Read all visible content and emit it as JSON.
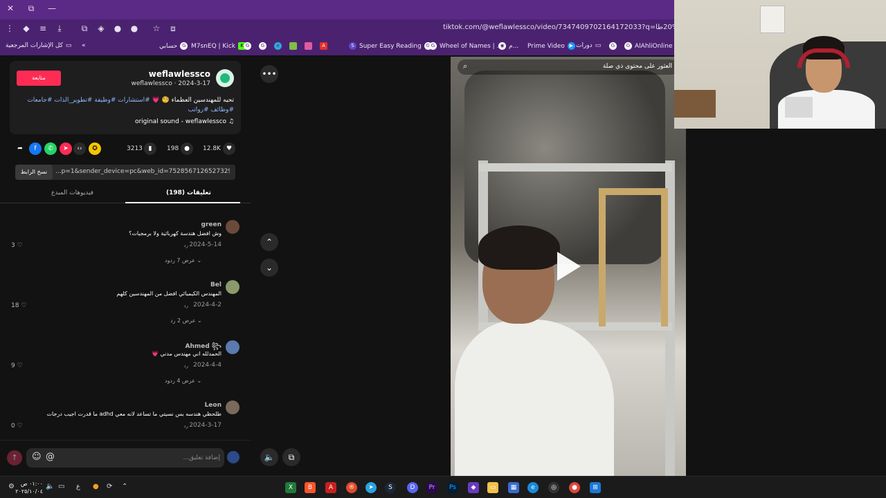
{
  "window": {
    "close": "✕",
    "restore": "⧉",
    "minimize": "—"
  },
  "toolbar": {
    "url": "tiktok.com/@weflawlessco/video/7347409702164172033?q=مهندس%20%20طا"
  },
  "bookmarks": [
    {
      "label": "كل الإشارات المرجعية"
    },
    {
      "label": "حسابي"
    },
    {
      "label": "M7snEQ | Kick"
    },
    {
      "label": "دورات"
    },
    {
      "label": "Prime Video"
    },
    {
      "label": "م..."
    },
    {
      "label": "Wheel of Names | ..."
    },
    {
      "label": "Super Easy Reading"
    },
    {
      "label": "AlAhliOnline"
    }
  ],
  "post": {
    "username": "weflawlessco",
    "meta": "weflawlessco · 2024-3-17",
    "follow_label": "متابعة",
    "caption_text": "تحيه للمهندسين العظماء 🧐 💗",
    "caption_tags": "#استشارات #وظيفة #تطوير_الذات #جامعات #وظائف #رواتب",
    "sound": "original sound - weflawlessco ♫",
    "likes": "12.8K",
    "comments": "198",
    "saves": "3213",
    "copy_link_label": "نسخ الرابط",
    "link": "...p=1&sender_device=pc&web_id=7528567126527329810"
  },
  "tabs": {
    "comments": "تعليقات (198)",
    "creator_videos": "فيديوهات المبدع"
  },
  "comments": [
    {
      "name": "green",
      "text": "وش افضل هندسة كهربائية ولا برمجيات؟",
      "date": "2024-5-14",
      "reply": "رد",
      "likes": "3 ♡",
      "view_replies": "عرض 7 ردود ⌄"
    },
    {
      "name": "Bel",
      "text": "المهندس الكيميائي افضل من المهندسين كلهم",
      "date": "2024-4-2",
      "reply": "رد",
      "likes": "18 ♡",
      "view_replies": "عرض 2 رد ⌄"
    },
    {
      "name": "Ahmed ꧂",
      "text": "الحمدلله اني مهندس مدني 💗",
      "date": "2024-4-4",
      "reply": "رد",
      "likes": "9 ♡",
      "view_replies": "عرض 4 ردود ⌄"
    },
    {
      "name": "Leon",
      "text": "طلحظي هندسه بس نسيتي ما تساعد لانه معي adhd ما قدرت اجيب درجات",
      "date": "2024-3-17",
      "reply": "رد",
      "likes": "0 ♡",
      "view_replies": ""
    }
  ],
  "comment_input": {
    "placeholder": "إضافة تعليق..."
  },
  "video": {
    "search_text": "العثور على محتوى ذي صلة"
  },
  "taskbar": {
    "time": "٠١:٠٠ ص",
    "date": "٢٠٢٥/١٠/٠٤",
    "lang": "ع"
  },
  "colors": {
    "accent": "#fe2c55",
    "browser": "#4b2270",
    "link": "#8fb7ff"
  }
}
